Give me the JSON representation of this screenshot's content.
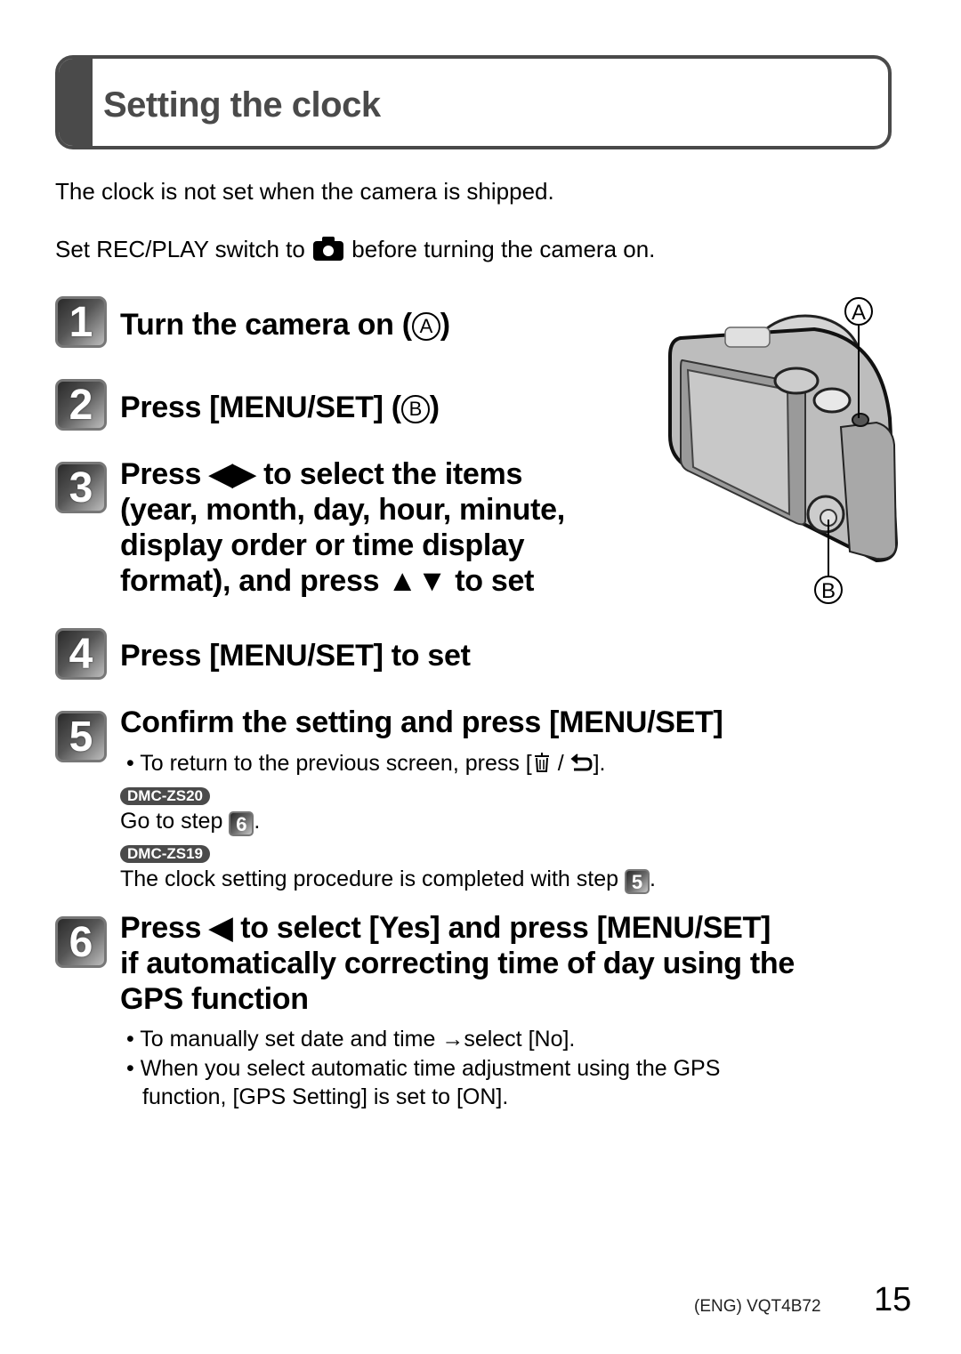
{
  "page": {
    "title": "Setting the clock",
    "intro": {
      "line1": "The clock is not set when the camera is shipped.",
      "line2_before": "Set REC/PLAY switch to",
      "line2_icon": "camera-icon",
      "line2_after": "before turning the camera on."
    },
    "steps": [
      {
        "number": "1",
        "title_before": "Turn the camera on (",
        "marker": "A",
        "title_after": ")"
      },
      {
        "number": "2",
        "title_before": "Press [MENU/SET] (",
        "marker": "B",
        "title_after": ")"
      },
      {
        "number": "3",
        "lines": [
          "Press ◀▶ to select the items",
          "(year, month, day, hour, minute,",
          "display order or time display",
          "format), and press ▲▼ to set"
        ]
      },
      {
        "number": "4",
        "title": "Press [MENU/SET] to set"
      },
      {
        "number": "5",
        "title": "Confirm the setting and press [MENU/SET]",
        "note_before": "• To return to the previous screen, press [",
        "note_icons": [
          "trash-icon",
          "return-icon"
        ],
        "note_after": "].",
        "models": [
          {
            "label": "DMC-ZS20",
            "text_before": "Go to step",
            "step_ref": "6",
            "text_after": "."
          },
          {
            "label": "DMC-ZS19",
            "text_before": "The clock setting procedure is completed with step",
            "step_ref": "5",
            "text_after": "."
          }
        ]
      },
      {
        "number": "6",
        "lines": [
          "Press ◀ to select [Yes] and press [MENU/SET]",
          "if automatically correcting time of day using the",
          "GPS function"
        ],
        "bullets": [
          "• To manually set date and time →select [No].",
          "• When you select automatic time adjustment using the GPS",
          "function, [GPS Setting] is set to [ON]."
        ]
      }
    ],
    "figure": {
      "label_a": "A",
      "label_b": "B"
    },
    "footer": {
      "code": "(ENG) VQT4B72",
      "page_number": "15"
    }
  }
}
